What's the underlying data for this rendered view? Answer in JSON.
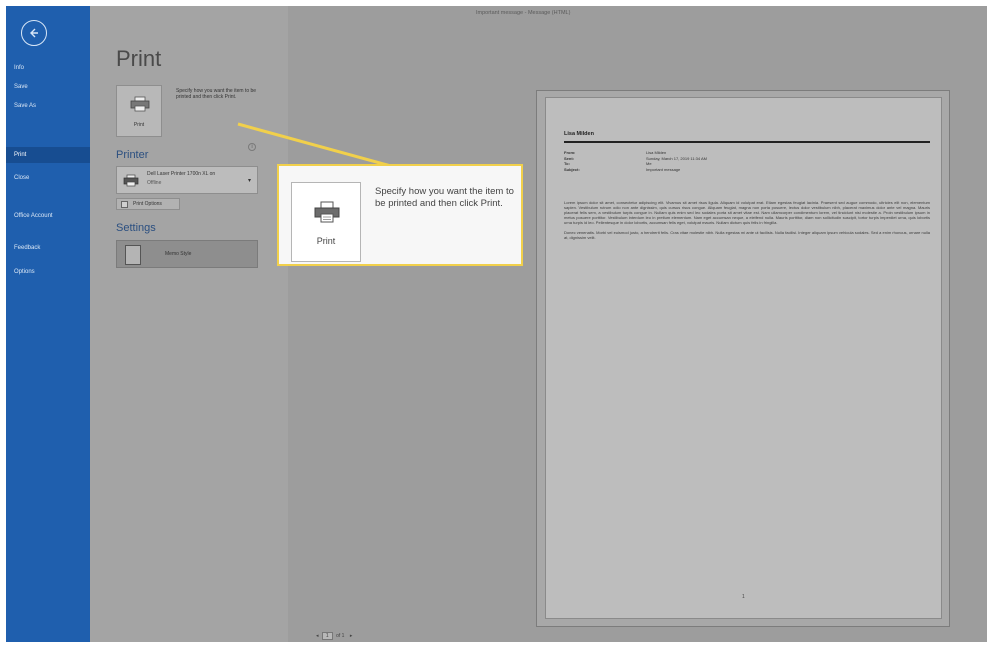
{
  "window_title": "Important message  -  Message (HTML)",
  "sidebar": {
    "items": [
      {
        "label": "Info"
      },
      {
        "label": "Save"
      },
      {
        "label": "Save As"
      },
      {
        "label": "Print",
        "active": true
      },
      {
        "label": "Close"
      },
      {
        "label": "Office Account"
      },
      {
        "label": "Feedback"
      },
      {
        "label": "Options"
      }
    ]
  },
  "print_panel": {
    "title": "Print",
    "print_button_label": "Print",
    "description": "Specify how you want the item to be printed and then click Print.",
    "printer_heading": "Printer",
    "printer_name": "Dell Laser Printer 1700n XL on",
    "printer_status": "Offline",
    "print_options_label": "Print Options",
    "settings_heading": "Settings",
    "style_name": "Memo Style"
  },
  "callout": {
    "button_label": "Print",
    "text": "Specify how you want the item to be printed and then click Print.",
    "border_color": "#f1d04b"
  },
  "preview": {
    "sender": "Lisa Milden",
    "headers": [
      {
        "key": "From:",
        "value": "Lisa Milden"
      },
      {
        "key": "Sent:",
        "value": "Sunday, March 17, 2019 11:34 AM"
      },
      {
        "key": "To:",
        "value": "Me"
      },
      {
        "key": "Subject:",
        "value": "Important message"
      }
    ],
    "body": [
      "Lorem ipsum dolor sit amet, consectetur adipiscing elit. Vivamus sit amet risus ligula. Aliquam id volutpat erat. Etiam egestas feugiat lacinia. Praesent sed augue commodo, ultricies elit non, elementum sapien. Vestibulum rutrum odio non ante dignissim, quis cursus risus congue. Aliquam feugiat, magna non porta posuere, lectus dolor vestibulum nibh, placerat maximus dolor ante vel magna. Mauris placerat felis sem, a vestibulum turpis congue in. Nullam quis enim sed leo sodales porta sit amet vitae est. Nam ullamcorper condimentum lorem, vel tincidunt nisi molestie a. Proin vestibulum ipsum in metus posuere porttitor. Vestibulum interdum leo in pretium elementum. Nam eget accumsan neque, a eleifend nulla. Mauris porttitor, diam non sollicitudin suscipit, tortor turpis imperdiet urna, quis lobortis urna turpis id leo. Pellentesque in dolor lobortis, accumsan felis eget, volutpat mauris. Nullam dictum quis felis in fringilla.",
      "Donec venenatis. Morbi vel euismod justo, a hendrerit felis. Cras vitae molestie nibh. Nulla egestas mi ante ut facilisis. Nulla facilisi. Integer aliquam ipsum vehicula sodales. Sed a enim rhoncus, ornare nulla at, dignissim velit."
    ],
    "page_number": "1"
  },
  "pager": {
    "prev": "◂",
    "current": "1",
    "of": "of 1",
    "next": "▸"
  },
  "colors": {
    "sidebar": "#1f5fae",
    "sidebar_active": "#174d91",
    "highlight": "#f1d04b"
  }
}
